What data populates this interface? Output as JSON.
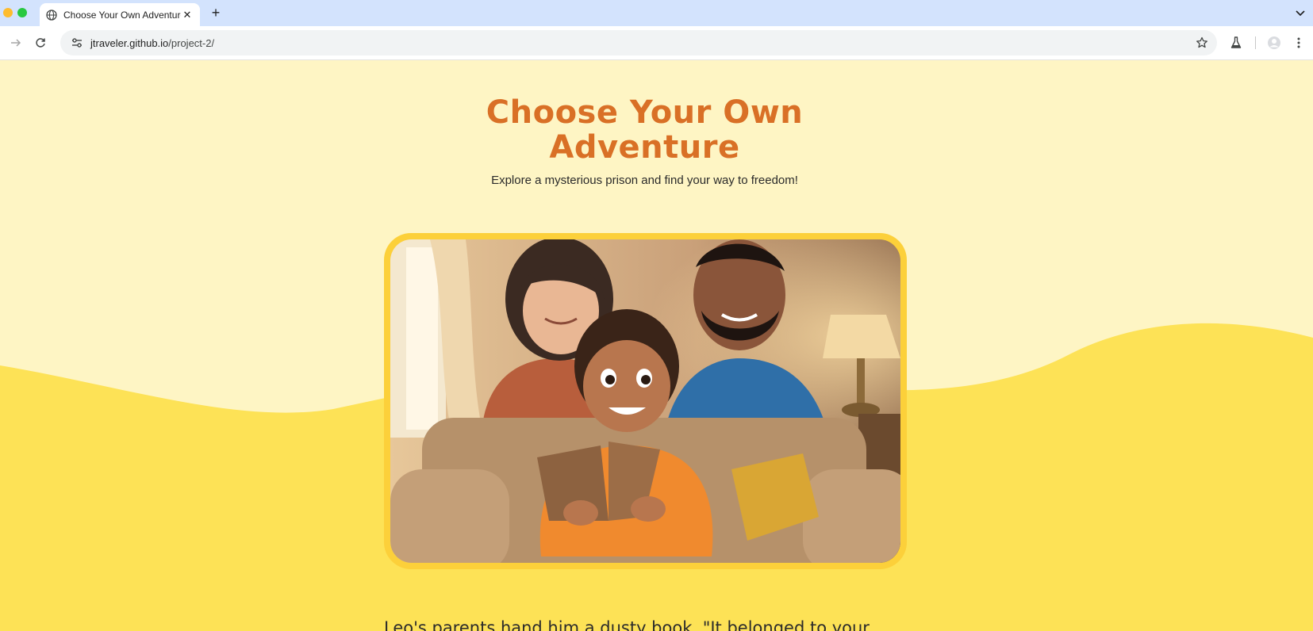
{
  "browser": {
    "tab_title": "Choose Your Own Adventure",
    "new_tab_label": "+",
    "close_label": "✕",
    "url_host": "jtraveler.github.io",
    "url_path": "/project-2/"
  },
  "page": {
    "title_line1": "Choose Your Own",
    "title_line2": "Adventure",
    "subtitle": "Explore a mysterious prison and find your way to freedom!",
    "story_text": "Leo's parents hand him a dusty book. \"It belonged to your"
  },
  "colors": {
    "page_bg": "#fef5c4",
    "wave": "#fde256",
    "title": "#d97026",
    "frame": "#fcd03a"
  }
}
